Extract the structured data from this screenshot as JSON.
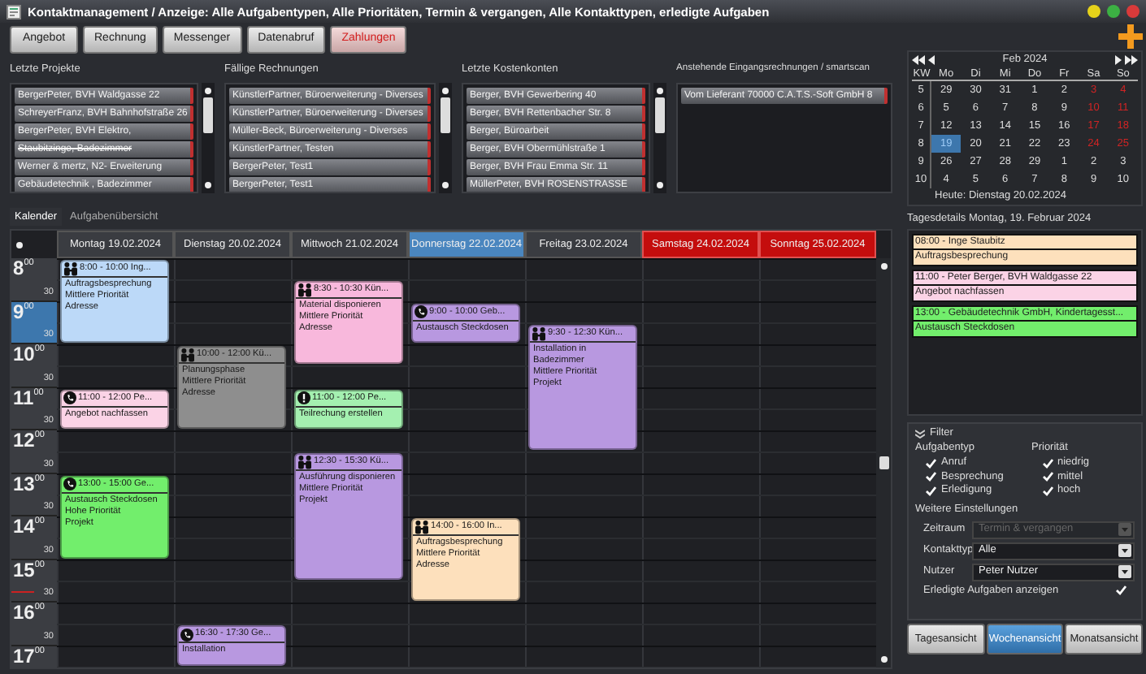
{
  "window": {
    "title": "Kontaktmanagement / Anzeige: Alle Aufgabentypen, Alle Prioritäten, Termin & vergangen, Alle Kontakttypen, erledigte Aufgaben"
  },
  "toolbar": [
    {
      "label": "Angebot",
      "kind": "normal"
    },
    {
      "label": "Rechnung",
      "kind": "normal"
    },
    {
      "label": "Messenger",
      "kind": "normal"
    },
    {
      "label": "Datenabruf",
      "kind": "normal"
    },
    {
      "label": "Zahlungen",
      "kind": "alert"
    }
  ],
  "lists": [
    {
      "title": "Letzte Projekte",
      "scrollbar": true,
      "items": [
        {
          "text": "BergerPeter, BVH Waldgasse 22",
          "done": false
        },
        {
          "text": "SchreyerFranz, BVH Bahnhofstraße 26",
          "done": false
        },
        {
          "text": "BergerPeter, BVH Elektro,",
          "done": false
        },
        {
          "text": "Staubitzinge, Badezimmer",
          "done": true
        },
        {
          "text": "Werner & mertz, N2- Erweiterung",
          "done": false
        },
        {
          "text": "Gebäudetechnik , Badezimmer",
          "done": false
        }
      ]
    },
    {
      "title": "Fällige Rechnungen",
      "scrollbar": true,
      "items": [
        {
          "text": "KünstlerPartner, Büroerweiterung - Diverses",
          "done": false
        },
        {
          "text": "KünstlerPartner, Büroerweiterung - Diverses",
          "done": false
        },
        {
          "text": "Müller-Beck, Büroerweiterung - Diverses",
          "done": false
        },
        {
          "text": "KünstlerPartner, Testen",
          "done": false
        },
        {
          "text": "BergerPeter, Test1",
          "done": false
        },
        {
          "text": "BergerPeter, Test1",
          "done": false
        }
      ]
    },
    {
      "title": "Letzte Kostenkonten",
      "scrollbar": true,
      "items": [
        {
          "text": "Berger, BVH Gewerbering 40",
          "done": false
        },
        {
          "text": "Berger, BVH Rettenbacher Str. 8",
          "done": false
        },
        {
          "text": "Berger, Büroarbeit",
          "done": false
        },
        {
          "text": "Berger, BVH  Obermühlstraße 1",
          "done": false
        },
        {
          "text": "Berger, BVH Frau Emma Str. 11",
          "done": false
        },
        {
          "text": "MüllerPeter, BVH ROSENSTRASSE",
          "done": false
        }
      ]
    },
    {
      "title": "Anstehende Eingangsrechnungen / smartscan",
      "scrollbar": false,
      "items": [
        {
          "text": "Vom Lieferant 70000 C.A.T.S.-Soft GmbH 8",
          "done": false
        }
      ]
    }
  ],
  "mini_calendar": {
    "month": "Feb 2024",
    "weekday_headers": [
      "KW",
      "Mo",
      "Di",
      "Mi",
      "Do",
      "Fr",
      "Sa",
      "So"
    ],
    "weeks": [
      {
        "kw": "5",
        "days": [
          {
            "d": "29",
            "red": false,
            "selected": false
          },
          {
            "d": "30",
            "red": false,
            "selected": false
          },
          {
            "d": "31",
            "red": false,
            "selected": false
          },
          {
            "d": "1",
            "red": false,
            "selected": false
          },
          {
            "d": "2",
            "red": false,
            "selected": false
          },
          {
            "d": "3",
            "red": true,
            "selected": false
          },
          {
            "d": "4",
            "red": true,
            "selected": false
          }
        ]
      },
      {
        "kw": "6",
        "days": [
          {
            "d": "5",
            "red": false,
            "selected": false
          },
          {
            "d": "6",
            "red": false,
            "selected": false
          },
          {
            "d": "7",
            "red": false,
            "selected": false
          },
          {
            "d": "8",
            "red": false,
            "selected": false
          },
          {
            "d": "9",
            "red": false,
            "selected": false
          },
          {
            "d": "10",
            "red": true,
            "selected": false
          },
          {
            "d": "11",
            "red": true,
            "selected": false
          }
        ]
      },
      {
        "kw": "7",
        "days": [
          {
            "d": "12",
            "red": false,
            "selected": false
          },
          {
            "d": "13",
            "red": false,
            "selected": false
          },
          {
            "d": "14",
            "red": false,
            "selected": false
          },
          {
            "d": "15",
            "red": false,
            "selected": false
          },
          {
            "d": "16",
            "red": false,
            "selected": false
          },
          {
            "d": "17",
            "red": true,
            "selected": false
          },
          {
            "d": "18",
            "red": true,
            "selected": false
          }
        ]
      },
      {
        "kw": "8",
        "days": [
          {
            "d": "19",
            "red": false,
            "selected": true
          },
          {
            "d": "20",
            "red": false,
            "selected": false
          },
          {
            "d": "21",
            "red": false,
            "selected": false
          },
          {
            "d": "22",
            "red": false,
            "selected": false
          },
          {
            "d": "23",
            "red": false,
            "selected": false
          },
          {
            "d": "24",
            "red": true,
            "selected": false
          },
          {
            "d": "25",
            "red": true,
            "selected": false
          }
        ]
      },
      {
        "kw": "9",
        "days": [
          {
            "d": "26",
            "red": false,
            "selected": false
          },
          {
            "d": "27",
            "red": false,
            "selected": false
          },
          {
            "d": "28",
            "red": false,
            "selected": false
          },
          {
            "d": "29",
            "red": false,
            "selected": false
          },
          {
            "d": "1",
            "red": false,
            "selected": false
          },
          {
            "d": "2",
            "red": false,
            "selected": false
          },
          {
            "d": "3",
            "red": false,
            "selected": false
          }
        ]
      },
      {
        "kw": "10",
        "days": [
          {
            "d": "4",
            "red": false,
            "selected": false
          },
          {
            "d": "5",
            "red": false,
            "selected": false
          },
          {
            "d": "6",
            "red": false,
            "selected": false
          },
          {
            "d": "7",
            "red": false,
            "selected": false
          },
          {
            "d": "8",
            "red": false,
            "selected": false
          },
          {
            "d": "9",
            "red": false,
            "selected": false
          },
          {
            "d": "10",
            "red": false,
            "selected": false
          }
        ]
      }
    ],
    "today": "Heute:  Dienstag 20.02.2024"
  },
  "tabs": [
    {
      "label": "Kalender",
      "selected": true
    },
    {
      "label": "Aufgabenübersicht",
      "selected": false
    }
  ],
  "calendar": {
    "days": [
      {
        "label": "Montag 19.02.2024",
        "kind": "weekday",
        "events": [
          {
            "kind": "meeting",
            "title": "8:00 - 10:00 Ing...",
            "lines": [
              "Auftragsbesprechung",
              "Mittlere Priorität",
              "Adresse"
            ],
            "color": "#bcd9f8"
          },
          {
            "kind": "call",
            "title": "11:00 - 12:00 Pe...",
            "lines": [
              "Angebot nachfassen"
            ],
            "color": "#fbd3e6"
          },
          {
            "kind": "call",
            "title": "13:00 - 15:00 Ge...",
            "lines": [
              "Austausch Steckdosen",
              "Hohe Priorität",
              "Projekt"
            ],
            "color": "#72ee6c"
          }
        ]
      },
      {
        "label": "Dienstag 20.02.2024",
        "kind": "weekday",
        "events": [
          {
            "kind": "meeting",
            "title": "10:00 - 12:00 Kü...",
            "lines": [
              "Planungsphase",
              "Mittlere Priorität",
              "Adresse"
            ],
            "color": "#8e8e8e"
          },
          {
            "kind": "call",
            "title": "16:30 - 17:30 Ge...",
            "lines": [
              "Installation"
            ],
            "color": "#b898e0"
          }
        ]
      },
      {
        "label": "Mittwoch 21.02.2024",
        "kind": "weekday",
        "events": [
          {
            "kind": "meeting",
            "title": "8:30 - 10:30 Kün...",
            "lines": [
              "Material disponieren",
              "Mittlere Priorität",
              "Adresse"
            ],
            "color": "#f8b8dc"
          },
          {
            "kind": "task",
            "title": "11:00 - 12:00 Pe...",
            "lines": [
              "Teilrechung erstellen"
            ],
            "color": "#a4f0b0"
          },
          {
            "kind": "meeting",
            "title": "12:30 - 15:30 Kü...",
            "lines": [
              "Ausführung disponieren",
              "Mittlere Priorität",
              "Projekt"
            ],
            "color": "#b898e0"
          }
        ]
      },
      {
        "label": "Donnerstag 22.02.2024",
        "kind": "selected",
        "events": [
          {
            "kind": "call",
            "title": "9:00 - 10:00 Geb...",
            "lines": [
              "Austausch Steckdosen"
            ],
            "color": "#b898e0"
          },
          {
            "kind": "meeting",
            "title": "14:00 - 16:00 In...",
            "lines": [
              "Auftragsbesprechung",
              "Mittlere Priorität",
              "Adresse"
            ],
            "color": "#fde0bc"
          }
        ]
      },
      {
        "label": "Freitag 23.02.2024",
        "kind": "weekday",
        "events": [
          {
            "kind": "meeting",
            "title": "9:30 - 12:30 Kün...",
            "lines": [
              "Installation in Badezimmer",
              "Mittlere Priorität",
              "Projekt"
            ],
            "color": "#b898e0"
          }
        ]
      },
      {
        "label": "Samstag 24.02.2024",
        "kind": "weekend"
      },
      {
        "label": "Sonntag 25.02.2024",
        "kind": "weekend"
      }
    ],
    "hours": [
      {
        "hour": "8",
        "minutes": "00",
        "half": "30",
        "highlighted": false
      },
      {
        "hour": "9",
        "minutes": "00",
        "half": "30",
        "highlighted": true
      },
      {
        "hour": "10",
        "minutes": "00",
        "half": "30",
        "highlighted": false
      },
      {
        "hour": "11",
        "minutes": "00",
        "half": "30",
        "highlighted": false
      },
      {
        "hour": "12",
        "minutes": "00",
        "half": "30",
        "highlighted": false
      },
      {
        "hour": "13",
        "minutes": "00",
        "half": "30",
        "highlighted": false
      },
      {
        "hour": "14",
        "minutes": "00",
        "half": "30",
        "highlighted": false
      },
      {
        "hour": "15",
        "minutes": "00",
        "half": "30",
        "highlighted": false
      },
      {
        "hour": "16",
        "minutes": "00",
        "half": "30",
        "highlighted": false
      },
      {
        "hour": "17",
        "minutes": "00",
        "highlighted": false
      }
    ]
  },
  "day_details": {
    "title": "Tagesdetails Montag, 19. Februar 2024",
    "entries": [
      {
        "head": "08:00 - Inge Staubitz",
        "sub": "Auftragsbesprechung",
        "color": "#fde0bc"
      },
      {
        "head": "11:00 - Peter Berger, BVH Waldgasse 22",
        "sub": "Angebot nachfassen",
        "color": "#fbd3e6"
      },
      {
        "head": "13:00 - Gebäudetechnik GmbH, Kindertagesst...",
        "sub": "Austausch Steckdosen",
        "color": "#72ee6c"
      }
    ]
  },
  "filter": {
    "title": "Filter",
    "groups": [
      {
        "title": "Aufgabentyp",
        "options": [
          {
            "label": "Anruf",
            "checked": true
          },
          {
            "label": "Besprechung",
            "checked": true
          },
          {
            "label": "Erledigung",
            "checked": true
          }
        ]
      },
      {
        "title": "Priorität",
        "options": [
          {
            "label": "niedrig",
            "checked": true
          },
          {
            "label": "mittel",
            "checked": true
          },
          {
            "label": "hoch",
            "checked": true
          }
        ]
      }
    ],
    "more_title": "Weitere Einstellungen",
    "dropdowns": [
      {
        "label": "Zeitraum",
        "value": "Termin & vergangen",
        "disabled": true
      },
      {
        "label": "Kontakttyp",
        "value": "Alle",
        "disabled": false
      },
      {
        "label": "Nutzer",
        "value": "Peter Nutzer",
        "disabled": false
      }
    ],
    "show_done": {
      "label": "Erledigte Aufgaben anzeigen",
      "checked": true
    }
  },
  "views": [
    {
      "label": "Tagesansicht",
      "selected": false
    },
    {
      "label": "Wochenansicht",
      "selected": true
    },
    {
      "label": "Monatsansicht",
      "selected": false
    }
  ]
}
